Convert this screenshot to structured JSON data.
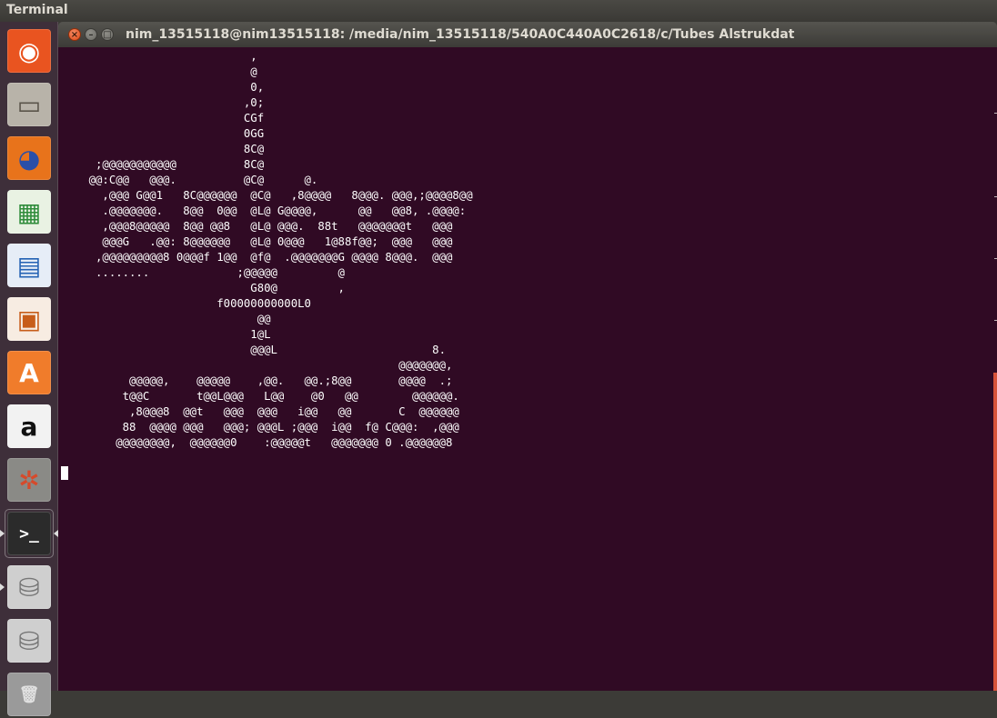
{
  "top_panel": {
    "app_name": "Terminal"
  },
  "window": {
    "title": "nim_13515118@nim13515118: /media/nim_13515118/540A0C440A0C2618/c/Tubes Alstrukdat",
    "buttons": {
      "close": "×",
      "minimize": "–",
      "maximize": "□"
    }
  },
  "launcher": {
    "items": [
      {
        "name": "ubuntu-dash",
        "glyph": "◉",
        "bg": "#e95420",
        "fg": "#ffffff"
      },
      {
        "name": "files",
        "glyph": "▭",
        "bg": "#b8b3a9",
        "fg": "#5a544a"
      },
      {
        "name": "firefox",
        "glyph": "◕",
        "bg": "#e8731b",
        "fg": "#2a4fa8"
      },
      {
        "name": "libreoffice-calc",
        "glyph": "▦",
        "bg": "#e9f2e3",
        "fg": "#2e8b3a"
      },
      {
        "name": "libreoffice-writer",
        "glyph": "▤",
        "bg": "#e6edf7",
        "fg": "#2462b4"
      },
      {
        "name": "libreoffice-impress",
        "glyph": "▣",
        "bg": "#f7ece2",
        "fg": "#c75d1a"
      },
      {
        "name": "software-center",
        "glyph": "A",
        "bg": "#f07c2b",
        "fg": "#ffffff"
      },
      {
        "name": "amazon",
        "glyph": "a",
        "bg": "#f2f2f2",
        "fg": "#111111"
      },
      {
        "name": "system-settings",
        "glyph": "✲",
        "bg": "#8a8a86",
        "fg": "#d64a2b"
      },
      {
        "name": "terminal",
        "glyph": ">_",
        "bg": "#2b2b2b",
        "fg": "#ffffff"
      },
      {
        "name": "drive-1",
        "glyph": "⛁",
        "bg": "#cfcfcf",
        "fg": "#777777"
      },
      {
        "name": "drive-2",
        "glyph": "⛁",
        "bg": "#cfcfcf",
        "fg": "#777777"
      },
      {
        "name": "trash",
        "glyph": "🗑",
        "bg": "#9a9a9a",
        "fg": "#e0e0e0"
      }
    ]
  },
  "terminal": {
    "lines": [
      "                            ,",
      "                            @",
      "                            0,",
      "                           ,0;",
      "                           CGf",
      "                           0GG",
      "                           8C@",
      "     ;@@@@@@@@@@@          8C@",
      "    @@:C@@   @@@.          @C@      @.",
      "      ,@@@ G@@1   8C@@@@@@  @C@   ,8@@@@   8@@@. @@@,;@@@@8@@",
      "      .@@@@@@@.   8@@  0@@  @L@ G@@@@,      @@   @@8, .@@@@:",
      "      ,@@@8@@@@@  8@@ @@8   @L@ @@@.  88t   @@@@@@@t   @@@",
      "      @@@G   .@@: 8@@@@@@   @L@ 0@@@   1@88f@@;  @@@   @@@",
      "     ,@@@@@@@@@8 0@@@f 1@@  @f@  .@@@@@@@G @@@@ 8@@@.  @@@",
      "     ........             ;@@@@@         @",
      "                            G80@         ,",
      "                       f00000000000L0",
      "                             @@",
      "                            1@L",
      "                            @@@L                       8.",
      "                                                  @@@@@@@,",
      "          @@@@@,    @@@@@    ,@@.   @@.;8@@       @@@@  .;",
      "         t@@C       t@@L@@@   L@@    @0   @@        @@@@@@.",
      "          ,8@@@8  @@t   @@@  @@@   i@@   @@       C  @@@@@@",
      "         88  @@@@ @@@   @@@; @@@L ;@@@  i@@  f@ C@@@:  ,@@@",
      "        @@@@@@@@,  @@@@@@0    :@@@@@t   @@@@@@@ 0 .@@@@@@8"
    ]
  }
}
